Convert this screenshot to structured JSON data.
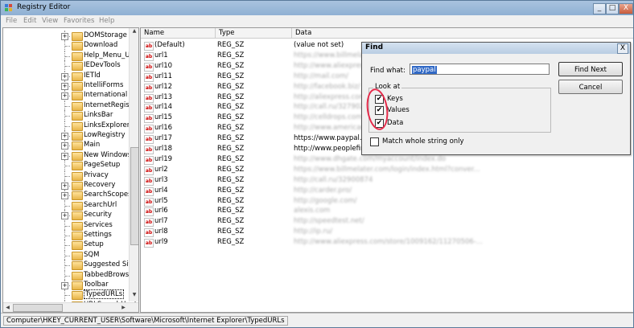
{
  "window": {
    "title": "Registry Editor",
    "min": "_",
    "max": "□",
    "close": "X"
  },
  "menu": [
    "File",
    "Edit",
    "View",
    "Favorites",
    "Help"
  ],
  "tree": {
    "items": [
      {
        "label": "DOMStorage",
        "exp": "+"
      },
      {
        "label": "Download",
        "exp": ""
      },
      {
        "label": "Help_Menu_URL",
        "exp": ""
      },
      {
        "label": "IEDevTools",
        "exp": ""
      },
      {
        "label": "IETld",
        "exp": "+"
      },
      {
        "label": "IntelliForms",
        "exp": "+"
      },
      {
        "label": "International",
        "exp": "+"
      },
      {
        "label": "InternetRegistry",
        "exp": ""
      },
      {
        "label": "LinksBar",
        "exp": ""
      },
      {
        "label": "LinksExplorer",
        "exp": ""
      },
      {
        "label": "LowRegistry",
        "exp": "+"
      },
      {
        "label": "Main",
        "exp": "+"
      },
      {
        "label": "New Windows",
        "exp": "+"
      },
      {
        "label": "PageSetup",
        "exp": ""
      },
      {
        "label": "Privacy",
        "exp": ""
      },
      {
        "label": "Recovery",
        "exp": "+"
      },
      {
        "label": "SearchScopes",
        "exp": "+"
      },
      {
        "label": "SearchUrl",
        "exp": ""
      },
      {
        "label": "Security",
        "exp": "+"
      },
      {
        "label": "Services",
        "exp": ""
      },
      {
        "label": "Settings",
        "exp": ""
      },
      {
        "label": "Setup",
        "exp": ""
      },
      {
        "label": "SQM",
        "exp": ""
      },
      {
        "label": "Suggested Sites",
        "exp": ""
      },
      {
        "label": "TabbedBrowsing",
        "exp": ""
      },
      {
        "label": "Toolbar",
        "exp": "+"
      },
      {
        "label": "TypedURLs",
        "exp": "",
        "selected": true
      },
      {
        "label": "URLSearchHooks",
        "exp": ""
      }
    ]
  },
  "list": {
    "headers": [
      "Name",
      "Type",
      "Data"
    ],
    "rows": [
      {
        "name": "(Default)",
        "type": "REG_SZ",
        "data": "(value not set)",
        "blur": false
      },
      {
        "name": "url1",
        "type": "REG_SZ",
        "data": "https://www.billmelater.com/",
        "blur": true
      },
      {
        "name": "url10",
        "type": "REG_SZ",
        "data": "http://www.aliexpress.com/",
        "blur": true
      },
      {
        "name": "url11",
        "type": "REG_SZ",
        "data": "http://mail.com/",
        "blur": true
      },
      {
        "name": "url12",
        "type": "REG_SZ",
        "data": "http://facebook.biz/",
        "blur": true
      },
      {
        "name": "url13",
        "type": "REG_SZ",
        "data": "http://aliexpress.com/",
        "blur": true
      },
      {
        "name": "url14",
        "type": "REG_SZ",
        "data": "http://call.ru/32790274",
        "blur": true
      },
      {
        "name": "url15",
        "type": "REG_SZ",
        "data": "http://celldrops.com/",
        "blur": true
      },
      {
        "name": "url16",
        "type": "REG_SZ",
        "data": "http://www.americanexpress.com/",
        "blur": true
      },
      {
        "name": "url17",
        "type": "REG_SZ",
        "data": "https://www.paypal.com/",
        "blur": false
      },
      {
        "name": "url18",
        "type": "REG_SZ",
        "data": "http://www.peoplefinders.com/",
        "blur": false
      },
      {
        "name": "url19",
        "type": "REG_SZ",
        "data": "http://www.dhgate.com/myaccount/index.do",
        "blur": true
      },
      {
        "name": "url2",
        "type": "REG_SZ",
        "data": "https://www.billmelater.com/login/index.html?conver...",
        "blur": true
      },
      {
        "name": "url3",
        "type": "REG_SZ",
        "data": "http://call.ru/32900874",
        "blur": true
      },
      {
        "name": "url4",
        "type": "REG_SZ",
        "data": "http://carder.pro/",
        "blur": true
      },
      {
        "name": "url5",
        "type": "REG_SZ",
        "data": "http://google.com/",
        "blur": true
      },
      {
        "name": "url6",
        "type": "REG_SZ",
        "data": "alexis.com",
        "blur": true
      },
      {
        "name": "url7",
        "type": "REG_SZ",
        "data": "http://speedtest.net/",
        "blur": true
      },
      {
        "name": "url8",
        "type": "REG_SZ",
        "data": "http://ip.ru/",
        "blur": true
      },
      {
        "name": "url9",
        "type": "REG_SZ",
        "data": "http://www.aliexpress.com/store/1009162/11270506-...",
        "blur": true
      }
    ]
  },
  "status": "Computer\\HKEY_CURRENT_USER\\Software\\Microsoft\\Internet Explorer\\TypedURLs",
  "find": {
    "title": "Find",
    "close": "X",
    "find_what_label": "Find what:",
    "find_what_value": "paypal",
    "find_next": "Find Next",
    "cancel": "Cancel",
    "look_at": "Look at",
    "keys": "Keys",
    "values": "Values",
    "data": "Data",
    "match_whole": "Match whole string only",
    "check_mark": "✔"
  },
  "colors": {
    "annotation": "#e52a4a",
    "selection": "#3169c6"
  }
}
